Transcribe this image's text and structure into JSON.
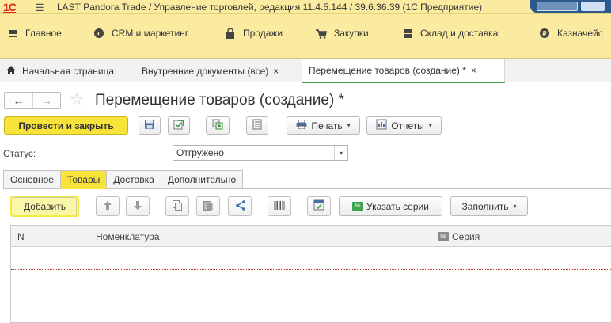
{
  "titlebar": {
    "logo": "1С",
    "title": "LAST Pandora Trade / Управление торговлей, редакция 11.4.5.144 / 39.6.36.39  (1С:Предприятие)"
  },
  "sections": [
    {
      "label": "Главное",
      "icon": "menu-icon"
    },
    {
      "label": "CRM и маркетинг",
      "icon": "crm-icon"
    },
    {
      "label": "Продажи",
      "icon": "shopping-bag-icon"
    },
    {
      "label": "Закупки",
      "icon": "cart-icon"
    },
    {
      "label": "Склад и доставка",
      "icon": "warehouse-icon"
    },
    {
      "label": "Казначейс",
      "icon": "ruble-icon"
    }
  ],
  "window_tabs": [
    {
      "label": "Начальная страница",
      "icon": "home-icon"
    },
    {
      "label": "Внутренние документы (все)",
      "close": "×"
    },
    {
      "label": "Перемещение товаров (создание) *",
      "close": "×",
      "active": true
    }
  ],
  "form": {
    "nav_back": "←",
    "nav_forward": "→",
    "favorite": "☆",
    "title": "Перемещение товаров (создание) *"
  },
  "command_bar": {
    "post_and_close": "Провести и закрыть",
    "print": "Печать",
    "reports": "Отчеты"
  },
  "status": {
    "label": "Статус:",
    "value": "Отгружено"
  },
  "page_tabs": [
    {
      "label": "Основное"
    },
    {
      "label": "Товары",
      "active": true
    },
    {
      "label": "Доставка"
    },
    {
      "label": "Дополнительно"
    }
  ],
  "table_toolbar": {
    "add": "Добавить",
    "specify_series": "Указать серии",
    "fill": "Заполнить",
    "series_badge": "№"
  },
  "grid": {
    "columns": [
      "N",
      "Номенклатура",
      "Серия"
    ]
  },
  "colors": {
    "accent_yellow": "#f8e33a",
    "panel_yellow": "#fbeba1",
    "active_tab_underline": "#3ea34a",
    "logo_red": "#d9251d"
  }
}
